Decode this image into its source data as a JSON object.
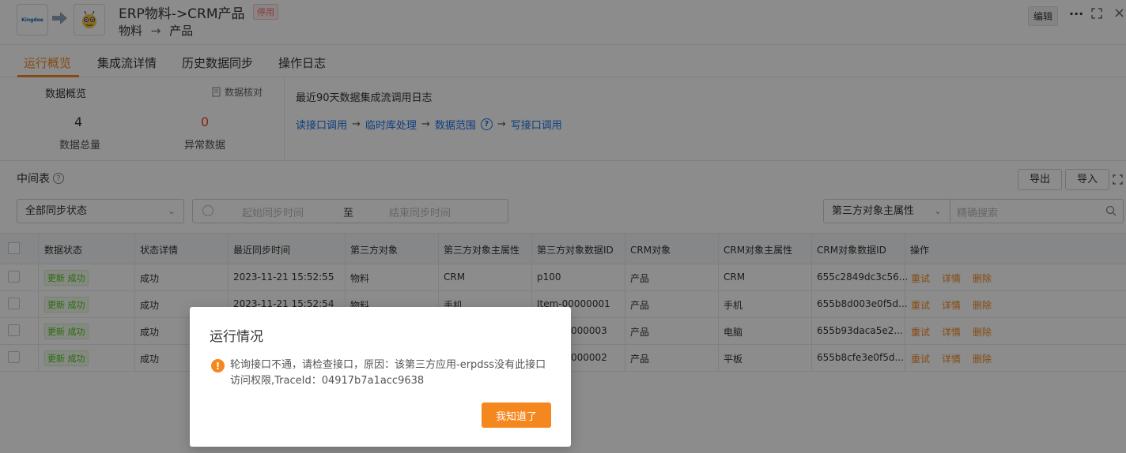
{
  "header": {
    "title": "ERP物料->CRM产品",
    "status_badge": "停用",
    "subtitle_from": "物料",
    "subtitle_arrow": "→",
    "subtitle_to": "产品",
    "source_logo_text": "Kingdee",
    "edit_label": "编辑"
  },
  "tabs": [
    {
      "label": "运行概览",
      "active": true
    },
    {
      "label": "集成流详情",
      "active": false
    },
    {
      "label": "历史数据同步",
      "active": false
    },
    {
      "label": "操作日志",
      "active": false
    }
  ],
  "overview": {
    "title": "数据概览",
    "check_label": "数据核对",
    "total_value": "4",
    "total_label": "数据总量",
    "abnormal_value": "0",
    "abnormal_label": "异常数据",
    "abnormal_color": "#f5471f",
    "log_title": "最近90天数据集成流调用日志",
    "flow": [
      "读接口调用",
      "临时库处理",
      "数据范围",
      "写接口调用"
    ]
  },
  "mid_table": {
    "title": "中间表",
    "export_label": "导出",
    "import_label": "导入"
  },
  "filters": {
    "status_value": "全部同步状态",
    "date_start_placeholder": "起始同步时间",
    "date_separator": "至",
    "date_end_placeholder": "结束同步时间",
    "field_select_value": "第三方对象主属性",
    "search_placeholder": "精确搜索"
  },
  "table": {
    "columns": [
      "数据状态",
      "状态详情",
      "最近同步时间",
      "第三方对象",
      "第三方对象主属性",
      "第三方对象数据ID",
      "CRM对象",
      "CRM对象主属性",
      "CRM对象数据ID",
      "操作"
    ],
    "rows": [
      {
        "status": "更新 成功",
        "detail": "成功",
        "time": "2023-11-21 15:52:55",
        "obj": "物料",
        "attr": "CRM",
        "id": "p100",
        "crm_obj": "产品",
        "crm_attr": "CRM",
        "crm_id": "655c2849dc3c56..."
      },
      {
        "status": "更新 成功",
        "detail": "成功",
        "time": "2023-11-21 15:52:54",
        "obj": "物料",
        "attr": "手机",
        "id": "Item-00000001",
        "crm_obj": "产品",
        "crm_attr": "手机",
        "crm_id": "655b8d003e0f5d..."
      },
      {
        "status": "更新 成功",
        "detail": "成功",
        "time": "",
        "obj": "",
        "attr": "",
        "id": "000003",
        "crm_obj": "产品",
        "crm_attr": "电脑",
        "crm_id": "655b93daca5e2..."
      },
      {
        "status": "更新 成功",
        "detail": "成功",
        "time": "",
        "obj": "",
        "attr": "",
        "id": "000002",
        "crm_obj": "产品",
        "crm_attr": "平板",
        "crm_id": "655b8cfe3e0f5d..."
      }
    ],
    "actions": [
      "重试",
      "详情",
      "删除"
    ]
  },
  "dialog": {
    "title": "运行情况",
    "message": "轮询接口不通，请检查接口，原因：该第三方应用-erpdss没有此接口访问权限,TraceId：04917b7a1acc9638",
    "confirm_label": "我知道了"
  },
  "colors": {
    "accent": "#f5871f",
    "link": "#1a73e8",
    "success": "#52c41a"
  }
}
